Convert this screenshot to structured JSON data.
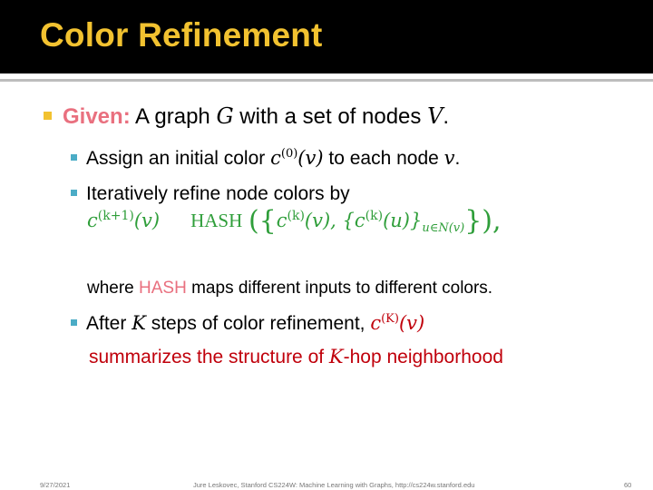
{
  "slide": {
    "title": "Color Refinement",
    "bullet1": {
      "label": "Given:",
      "text_a": " A graph ",
      "var_g": "G",
      "text_b": " with a set of nodes ",
      "var_v": "V",
      "text_c": "."
    },
    "bullet2": {
      "text_a": "Assign an initial color ",
      "math": "c",
      "sup": "(0)",
      "math_arg": "(v)",
      "text_b": " to each node ",
      "var": "v",
      "text_c": "."
    },
    "bullet3": {
      "text": "Iteratively refine node colors by"
    },
    "formula": {
      "lhs": "c",
      "lhs_sup": "(k+1)",
      "lhs_arg": "(v)",
      "hash": "HASH",
      "open": "({",
      "c1": "c",
      "c1_sup": "(k)",
      "c1_arg": "(v), {",
      "c2": "c",
      "c2_sup": "(k)",
      "c2_arg": "(u)}",
      "sub": "u∈N(v)",
      "close": "}),"
    },
    "where": {
      "a": "where ",
      "hash": "HASH",
      "b": " maps different inputs to different colors."
    },
    "bullet4": {
      "text_a": "After ",
      "var_k": "K",
      "text_b": " steps of color refinement, ",
      "math": "c",
      "sup": "(K)",
      "math_arg": "(v)"
    },
    "bullet4_line2": {
      "text_a": "summarizes the structure of ",
      "var_k": "K",
      "text_b": "-hop neighborhood"
    }
  },
  "footer": {
    "date": "9/27/2021",
    "center": "Jure Leskovec, Stanford CS224W: Machine Learning with Graphs, http://cs224w.stanford.edu",
    "page": "60"
  },
  "colors": {
    "title": "#f2c230",
    "accent_pink": "#e9707f",
    "dark_red": "#c0000b",
    "formula_green": "#2f9e3a",
    "bullet_blue": "#4bacc6"
  }
}
